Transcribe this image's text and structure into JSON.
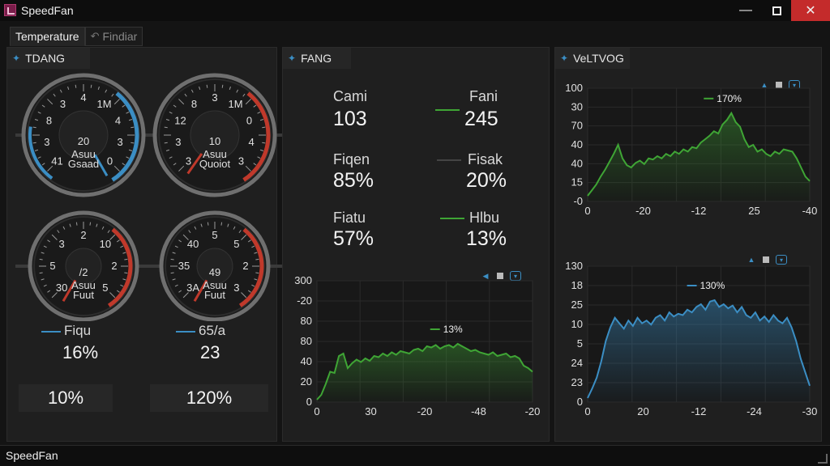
{
  "window": {
    "title": "SpeedFan",
    "icon": "speedfan-app-icon"
  },
  "tabs": [
    {
      "label": "Temperature",
      "active": true
    },
    {
      "label": "Findiar",
      "active": false,
      "icon": "undo-icon"
    }
  ],
  "colors": {
    "accent_blue": "#3b8ec4",
    "green": "#3fa535",
    "red": "#c0392b",
    "panel": "#1f1f1f"
  },
  "temp_panel": {
    "title": "TDANG",
    "gauges": [
      {
        "value": "20",
        "sub1": "Asuu",
        "sub2": "Gsaad",
        "scale": [
          "41",
          "3",
          "8",
          "3",
          "4",
          "1M",
          "4",
          "3",
          "0"
        ]
      },
      {
        "value": "10",
        "sub1": "Asuu",
        "sub2": "Quoiot",
        "scale": [
          "3",
          "3",
          "12",
          "8",
          "3",
          "1M",
          "0",
          "4",
          "3"
        ]
      },
      {
        "value": "/2",
        "sub1": "Asuu",
        "sub2": "Fuut",
        "scale": [
          "30",
          "5",
          "3",
          "2",
          "10",
          "2",
          "5"
        ]
      },
      {
        "value": "49",
        "sub1": "Asuu",
        "sub2": "Fuut",
        "scale": [
          "3A",
          "35",
          "40",
          "5",
          "5",
          "2",
          "3"
        ]
      }
    ],
    "stats": [
      {
        "label": "Fiqu",
        "value": "16%"
      },
      {
        "label": "65/a",
        "value": "23"
      }
    ],
    "tiles": [
      "10%",
      "120%"
    ]
  },
  "fan_panel": {
    "title": "FANG",
    "readouts": [
      {
        "label": "Cami",
        "value": "103"
      },
      {
        "label": "Fani",
        "value": "245"
      },
      {
        "label": "Fiqen",
        "value": "85%"
      },
      {
        "label": "Fisak",
        "value": "20%"
      },
      {
        "label": "Fiatu",
        "value": "57%"
      },
      {
        "label": "Hlbu",
        "value": "13%"
      }
    ]
  },
  "volt_panel": {
    "title": "VeLTVOG"
  },
  "chart_data": [
    {
      "type": "area",
      "panel": "fan",
      "y_tick_labels": [
        "300",
        "-20",
        "80",
        "80",
        "40",
        "20",
        "0"
      ],
      "x_tick_labels": [
        "0",
        "30",
        "-20",
        "-48",
        "-20"
      ],
      "annotation": "13%",
      "color": "#3fa535",
      "values": [
        2,
        6,
        15,
        25,
        24,
        38,
        40,
        28,
        32,
        35,
        33,
        36,
        34,
        38,
        37,
        40,
        38,
        41,
        39,
        42,
        41,
        40,
        43,
        44,
        42,
        46,
        45,
        47,
        44,
        46,
        47,
        45,
        48,
        46,
        44,
        42,
        43,
        41,
        40,
        39,
        41,
        38,
        39,
        40,
        37,
        38,
        36,
        30,
        28,
        25
      ],
      "ylim": [
        0,
        100
      ]
    },
    {
      "type": "area",
      "panel": "volt-top",
      "y_tick_labels": [
        "100",
        "30",
        "70",
        "40",
        "40",
        "15",
        "-0"
      ],
      "x_tick_labels": [
        "0",
        "-20",
        "-12",
        "25",
        "-40"
      ],
      "annotation": "170%",
      "color": "#3fa535",
      "values": [
        5,
        10,
        15,
        22,
        28,
        35,
        42,
        50,
        38,
        32,
        30,
        34,
        36,
        33,
        38,
        37,
        40,
        38,
        42,
        40,
        44,
        42,
        46,
        44,
        48,
        47,
        52,
        55,
        58,
        62,
        60,
        68,
        72,
        78,
        70,
        66,
        55,
        48,
        50,
        44,
        46,
        42,
        40,
        44,
        42,
        46,
        45,
        44,
        38,
        30,
        22,
        18
      ],
      "ylim": [
        0,
        100
      ]
    },
    {
      "type": "area",
      "panel": "volt-bottom",
      "y_tick_labels": [
        "130",
        "18",
        "25",
        "10",
        "5",
        "24",
        "23",
        "0"
      ],
      "x_tick_labels": [
        "0",
        "20",
        "-12",
        "-24",
        "-30"
      ],
      "annotation": "130%",
      "color": "#3b8ec4",
      "values": [
        3,
        10,
        18,
        30,
        45,
        55,
        62,
        58,
        54,
        60,
        56,
        62,
        58,
        60,
        57,
        62,
        64,
        60,
        66,
        63,
        65,
        64,
        68,
        66,
        70,
        72,
        68,
        74,
        75,
        70,
        72,
        69,
        71,
        66,
        70,
        64,
        62,
        66,
        60,
        63,
        59,
        64,
        60,
        58,
        62,
        55,
        45,
        32,
        22,
        12
      ],
      "ylim": [
        0,
        100
      ]
    }
  ],
  "statusbar": {
    "text": "SpeedFan"
  }
}
